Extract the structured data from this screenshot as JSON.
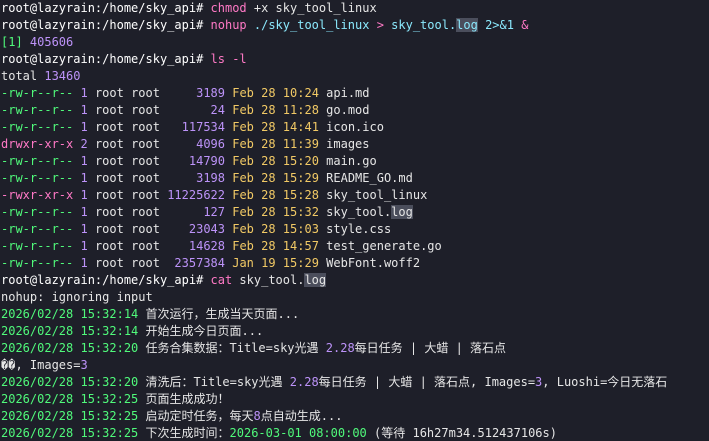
{
  "terminal": {
    "palette": {
      "prompt": "#ffffff",
      "command": "#8be9fd",
      "operator": "#ff79c6",
      "text": "#e6e6e6",
      "perm": "#50fa7b",
      "permdir": "#ff79c6",
      "number": "#bd93f9",
      "date": "#f1c965",
      "timestamp": "#50fa7b",
      "highlight_bg": "#4b4e5c"
    },
    "lines": [
      {
        "segs": [
          [
            "root@lazyrain:/home/sky_api# ",
            "prompt"
          ],
          [
            "chmod",
            "operator"
          ],
          [
            " +x sky_tool_linux",
            "text"
          ]
        ]
      },
      {
        "segs": [
          [
            "root@lazyrain:/home/sky_api# ",
            "prompt"
          ],
          [
            "nohup",
            "operator"
          ],
          [
            " ./sky_tool_linux ",
            "command"
          ],
          [
            ">",
            "operator"
          ],
          [
            " sky_tool.",
            "command"
          ],
          [
            "log",
            "command",
            "hl"
          ],
          [
            " 2>&1 ",
            "command"
          ],
          [
            "&",
            "operator"
          ]
        ]
      },
      {
        "segs": [
          [
            "[1] ",
            "perm"
          ],
          [
            "405606",
            "number"
          ]
        ]
      },
      {
        "segs": [
          [
            "root@lazyrain:/home/sky_api# ",
            "prompt"
          ],
          [
            "ls",
            "operator"
          ],
          [
            " -l",
            "operator"
          ]
        ]
      },
      {
        "segs": [
          [
            "total ",
            "text"
          ],
          [
            "13460",
            "number"
          ]
        ]
      },
      {
        "segs": [
          [
            "-rw-r--r-- ",
            "perm"
          ],
          [
            "1",
            "number"
          ],
          [
            " root root     ",
            "text"
          ],
          [
            "3189",
            "number"
          ],
          [
            " Feb 28 10:24",
            "date"
          ],
          [
            " api.md",
            "text"
          ]
        ]
      },
      {
        "segs": [
          [
            "-rw-r--r-- ",
            "perm"
          ],
          [
            "1",
            "number"
          ],
          [
            " root root       ",
            "text"
          ],
          [
            "24",
            "number"
          ],
          [
            " Feb 28 11:28",
            "date"
          ],
          [
            " go.mod",
            "text"
          ]
        ]
      },
      {
        "segs": [
          [
            "-rw-r--r-- ",
            "perm"
          ],
          [
            "1",
            "number"
          ],
          [
            " root root   ",
            "text"
          ],
          [
            "117534",
            "number"
          ],
          [
            " Feb 28 14:41",
            "date"
          ],
          [
            " icon.ico",
            "text"
          ]
        ]
      },
      {
        "segs": [
          [
            "drwxr-xr-x ",
            "permdir"
          ],
          [
            "2",
            "number"
          ],
          [
            " root root     ",
            "text"
          ],
          [
            "4096",
            "number"
          ],
          [
            " Feb 28 11:39",
            "date"
          ],
          [
            " images",
            "text"
          ]
        ]
      },
      {
        "segs": [
          [
            "-rw-r--r-- ",
            "perm"
          ],
          [
            "1",
            "number"
          ],
          [
            " root root    ",
            "text"
          ],
          [
            "14790",
            "number"
          ],
          [
            " Feb 28 15:20",
            "date"
          ],
          [
            " main.go",
            "text"
          ]
        ]
      },
      {
        "segs": [
          [
            "-rw-r--r-- ",
            "perm"
          ],
          [
            "1",
            "number"
          ],
          [
            " root root     ",
            "text"
          ],
          [
            "3198",
            "number"
          ],
          [
            " Feb 28 15:29",
            "date"
          ],
          [
            " README_GO.md",
            "text"
          ]
        ]
      },
      {
        "segs": [
          [
            "-rwxr-xr-x ",
            "permdir"
          ],
          [
            "1",
            "number"
          ],
          [
            " root root ",
            "text"
          ],
          [
            "11225622",
            "number"
          ],
          [
            " Feb 28 15:28",
            "date"
          ],
          [
            " sky_tool_linux",
            "text"
          ]
        ]
      },
      {
        "segs": [
          [
            "-rw-r--r-- ",
            "perm"
          ],
          [
            "1",
            "number"
          ],
          [
            " root root      ",
            "text"
          ],
          [
            "127",
            "number"
          ],
          [
            " Feb 28 15:32",
            "date"
          ],
          [
            " sky_tool.",
            "text"
          ],
          [
            "log",
            "text",
            "hl"
          ]
        ]
      },
      {
        "segs": [
          [
            "-rw-r--r-- ",
            "perm"
          ],
          [
            "1",
            "number"
          ],
          [
            " root root    ",
            "text"
          ],
          [
            "23043",
            "number"
          ],
          [
            " Feb 28 15:03",
            "date"
          ],
          [
            " style.css",
            "text"
          ]
        ]
      },
      {
        "segs": [
          [
            "-rw-r--r-- ",
            "perm"
          ],
          [
            "1",
            "number"
          ],
          [
            " root root    ",
            "text"
          ],
          [
            "14628",
            "number"
          ],
          [
            " Feb 28 14:57",
            "date"
          ],
          [
            " test_generate.go",
            "text"
          ]
        ]
      },
      {
        "segs": [
          [
            "-rw-r--r-- ",
            "perm"
          ],
          [
            "1",
            "number"
          ],
          [
            " root root  ",
            "text"
          ],
          [
            "2357384",
            "number"
          ],
          [
            " Jan 19 15:29",
            "date"
          ],
          [
            " WebFont.woff2",
            "text"
          ]
        ]
      },
      {
        "segs": [
          [
            "root@lazyrain:/home/sky_api# ",
            "prompt"
          ],
          [
            "cat",
            "operator"
          ],
          [
            " sky_tool.",
            "text"
          ],
          [
            "log",
            "text",
            "hl"
          ]
        ]
      },
      {
        "segs": [
          [
            "nohup: ignoring input",
            "text"
          ]
        ]
      },
      {
        "segs": [
          [
            "2026/02/28 15:32:14",
            "timestamp"
          ],
          [
            " 首次运行，生成当天页面...",
            "text"
          ]
        ]
      },
      {
        "segs": [
          [
            "2026/02/28 15:32:14",
            "timestamp"
          ],
          [
            " 开始生成今日页面...",
            "text"
          ]
        ]
      },
      {
        "segs": [
          [
            "2026/02/28 15:32:20",
            "timestamp"
          ],
          [
            " 任务合集数据：Title=sky光遇 ",
            "text"
          ],
          [
            "2.28",
            "number"
          ],
          [
            "每日任务 | 大蜡 | 落石点",
            "text"
          ]
        ]
      },
      {
        "segs": [
          [
            "��, Images=",
            "text"
          ],
          [
            "3",
            "number"
          ]
        ]
      },
      {
        "segs": [
          [
            "2026/02/28 15:32:20",
            "timestamp"
          ],
          [
            " 清洗后：Title=sky光遇 ",
            "text"
          ],
          [
            "2.28",
            "number"
          ],
          [
            "每日任务 | 大蜡 | 落石点, Images=",
            "text"
          ],
          [
            "3",
            "number"
          ],
          [
            ", Luoshi=今日无落石",
            "text"
          ]
        ]
      },
      {
        "segs": [
          [
            "2026/02/28 15:32:25",
            "timestamp"
          ],
          [
            " 页面生成成功！",
            "text"
          ]
        ]
      },
      {
        "segs": [
          [
            "2026/02/28 15:32:25",
            "timestamp"
          ],
          [
            " 启动定时任务，每天",
            "text"
          ],
          [
            "8",
            "number"
          ],
          [
            "点自动生成...",
            "text"
          ]
        ]
      },
      {
        "segs": [
          [
            "2026/02/28 15:32:25",
            "timestamp"
          ],
          [
            " 下次生成时间：",
            "text"
          ],
          [
            "2026-03-01 08:00:00",
            "timestamp"
          ],
          [
            " (等待 16h27m34.512437106s)",
            "text"
          ]
        ]
      }
    ]
  }
}
